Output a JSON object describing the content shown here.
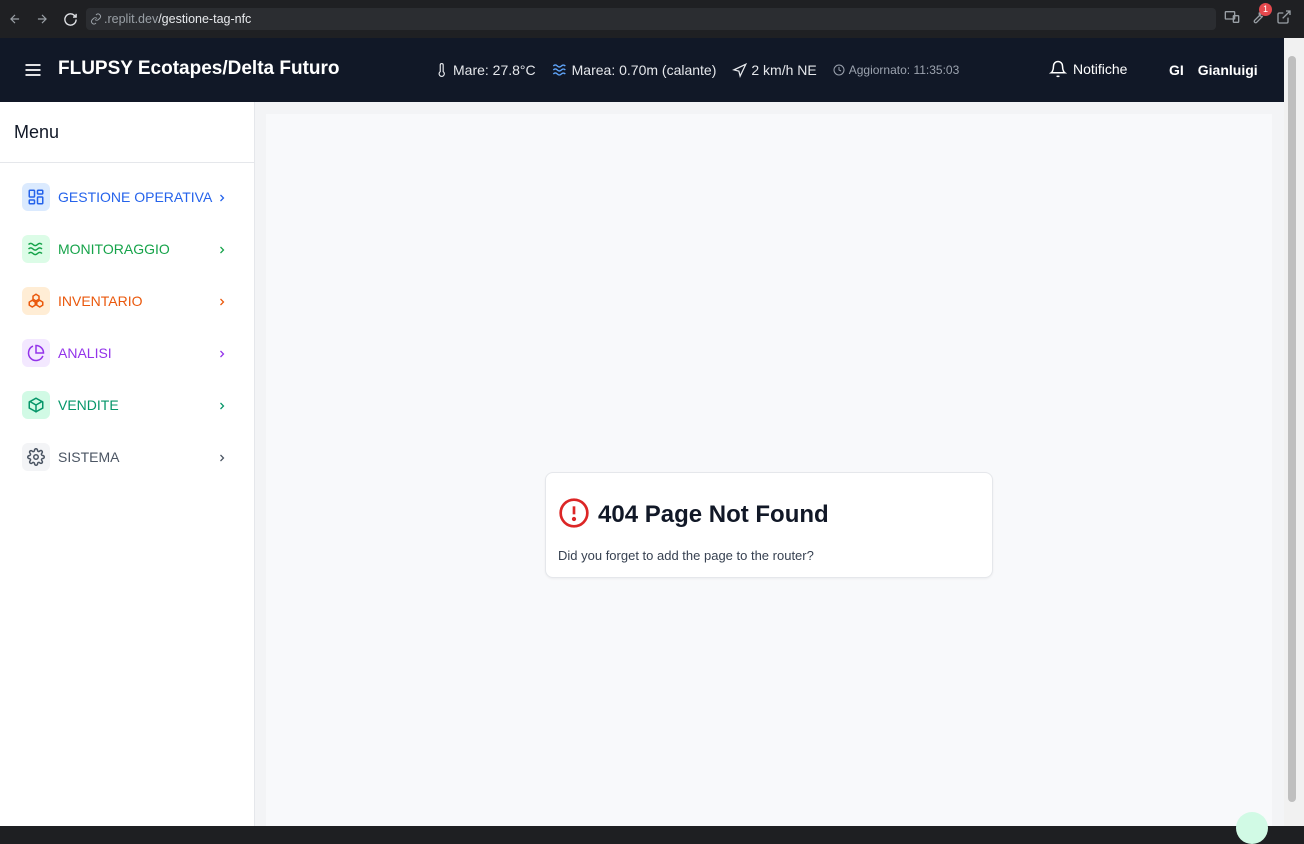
{
  "browser": {
    "url_host": ".replit.dev",
    "url_path": "/gestione-tag-nfc",
    "badge_count": "1"
  },
  "header": {
    "title": "FLUPSY Ecotapes/Delta Futuro",
    "weather": {
      "sea": "Mare: 27.8°C",
      "tide": "Marea: 0.70m (calante)",
      "wind": "2 km/h NE",
      "updated": "Aggiornato: 11:35:03"
    },
    "notifications_label": "Notifiche",
    "user_initials": "GI",
    "user_name": "Gianluigi"
  },
  "sidebar": {
    "title": "Menu",
    "items": [
      {
        "label": "GESTIONE OPERATIVA",
        "icon": "layout-dashboard-icon",
        "color": "#2563eb",
        "bg": "#dbeafe"
      },
      {
        "label": "MONITORAGGIO",
        "icon": "waves-icon",
        "color": "#16a34a",
        "bg": "#dcfce7"
      },
      {
        "label": "INVENTARIO",
        "icon": "boxes-icon",
        "color": "#ea580c",
        "bg": "#ffedd5"
      },
      {
        "label": "ANALISI",
        "icon": "pie-chart-icon",
        "color": "#9333ea",
        "bg": "#f3e8ff"
      },
      {
        "label": "VENDITE",
        "icon": "package-icon",
        "color": "#059669",
        "bg": "#d1fae5"
      },
      {
        "label": "SISTEMA",
        "icon": "settings-icon",
        "color": "#4b5563",
        "bg": "#f3f4f6"
      }
    ]
  },
  "error": {
    "title": "404 Page Not Found",
    "description": "Did you forget to add the page to the router?",
    "color": "#dc2626"
  }
}
